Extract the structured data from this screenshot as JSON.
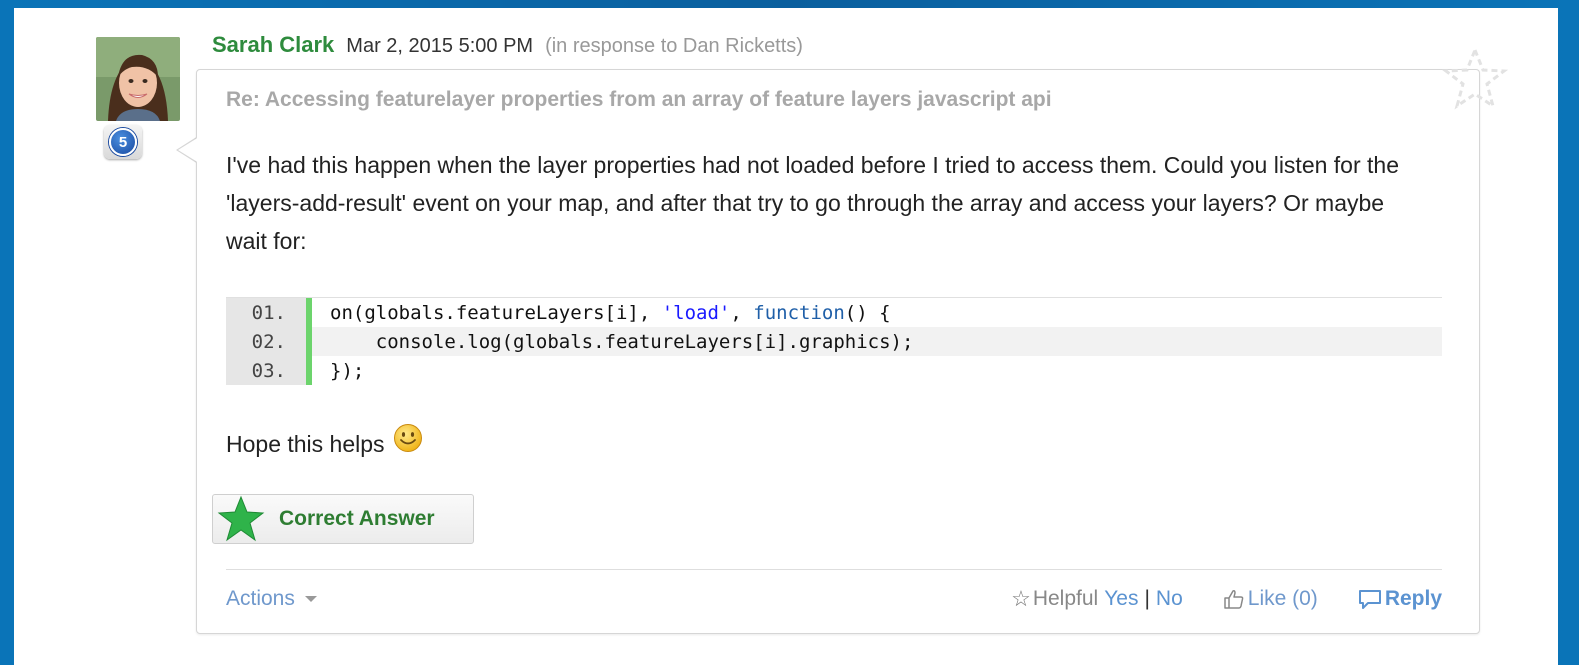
{
  "post": {
    "author": "Sarah Clark",
    "date": "Mar 2, 2015 5:00 PM",
    "in_response": "(in response to Dan Ricketts)",
    "rank": "5",
    "avatar_icon": "user-photo",
    "subject": "Re: Accessing featurelayer properties from an array of feature layers javascript api",
    "body": "I've had this happen when the layer properties had not loaded before I tried to access them. Could you listen for the 'layers-add-result' event on your map, and after that try to go through the array and access your layers? Or maybe wait for:",
    "code": [
      {
        "num": "01.",
        "pre": "on(globals.featureLayers[i], ",
        "str": "'load'",
        "mid": ", ",
        "kw": "function",
        "post": "() {"
      },
      {
        "num": "02.",
        "pre": "    console.log(globals.featureLayers[i].graphics);",
        "str": "",
        "mid": "",
        "kw": "",
        "post": ""
      },
      {
        "num": "03.",
        "pre": "});",
        "str": "",
        "mid": "",
        "kw": "",
        "post": ""
      }
    ],
    "closing": "Hope this helps",
    "correct_label": "Correct Answer"
  },
  "footer": {
    "actions_label": "Actions",
    "helpful_label": "Helpful",
    "yes_label": "Yes",
    "separator": "|",
    "no_label": "No",
    "like_label": "Like (0)",
    "reply_label": "Reply"
  },
  "colors": {
    "author": "#2e8b3d",
    "link": "#5b93d1",
    "correct_star": "#2fb34a",
    "code_gutter_bar": "#6cd46c"
  },
  "icons": [
    "star-outline-icon",
    "smiley-icon",
    "green-star-icon",
    "star-icon",
    "thumbs-up-icon",
    "speech-bubble-icon",
    "chevron-down-icon"
  ]
}
